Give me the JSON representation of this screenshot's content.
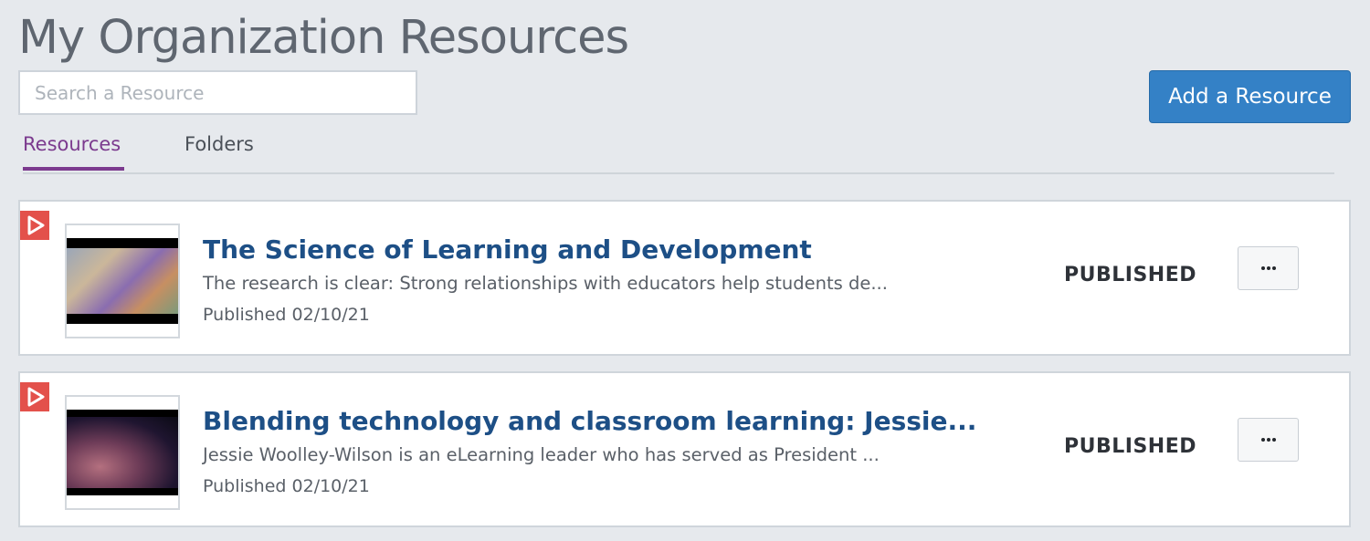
{
  "page": {
    "title": "My Organization Resources"
  },
  "search": {
    "placeholder": "Search a Resource",
    "value": ""
  },
  "actions": {
    "add_label": "Add a Resource"
  },
  "tabs": [
    {
      "label": "Resources",
      "active": true
    },
    {
      "label": "Folders",
      "active": false
    }
  ],
  "colors": {
    "background": "#e6e9ed",
    "accent_tab": "#7b3a8e",
    "primary_button": "#3481c6",
    "title_link": "#1d4f86",
    "video_badge": "#e3514b"
  },
  "resources": [
    {
      "type_icon": "play-icon",
      "title": "The Science of Learning and Development",
      "description": "The research is clear: Strong relationships with educators help students de...",
      "published": "Published 02/10/21",
      "status": "PUBLISHED",
      "menu_icon": "more-icon"
    },
    {
      "type_icon": "play-icon",
      "title": "Blending technology and classroom learning: Jessie...",
      "description": "Jessie Woolley-Wilson is an eLearning leader who has served as President ...",
      "published": "Published 02/10/21",
      "status": "PUBLISHED",
      "menu_icon": "more-icon"
    }
  ]
}
